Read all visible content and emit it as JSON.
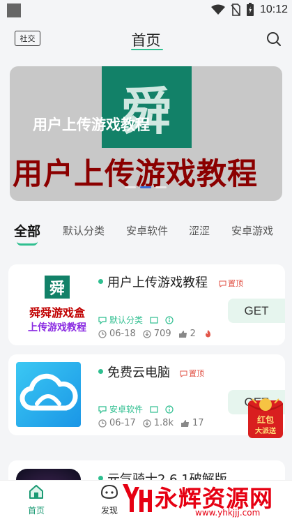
{
  "status_bar": {
    "time": "10:12",
    "icons": [
      "wifi-icon",
      "no-sim-icon",
      "battery-icon"
    ]
  },
  "header": {
    "left_tag": "社交",
    "title": "首页",
    "search_icon": "search-icon"
  },
  "banner": {
    "logo_char": "舜",
    "caption": "用户上传游戏教程",
    "headline": "用户上传游戏教程",
    "slide_count": 3,
    "active_slide": 2
  },
  "tabs": [
    {
      "label": "全部",
      "active": true
    },
    {
      "label": "默认分类",
      "active": false
    },
    {
      "label": "安卓软件",
      "active": false
    },
    {
      "label": "涩涩",
      "active": false
    },
    {
      "label": "安卓游戏",
      "active": false
    }
  ],
  "apps": [
    {
      "name": "用户上传游戏教程",
      "pin": "置顶",
      "category": "默认分类",
      "date": "06-18",
      "downloads": "709",
      "likes": "2",
      "hot": true,
      "action": "GET",
      "icon": {
        "logo_char": "舜",
        "line1": "舜舜游戏盒",
        "line2": "上传游戏教程"
      }
    },
    {
      "name": "免费云电脑",
      "pin": "置顶",
      "category": "安卓软件",
      "date": "06-17",
      "downloads": "1.8k",
      "likes": "17",
      "action": "GET",
      "icon": {
        "name": "cloud-icon"
      }
    },
    {
      "name": "元气骑士2.6.1破解版"
    }
  ],
  "red_packet": {
    "line1": "红包",
    "line2": "大派送"
  },
  "bottom_nav": [
    {
      "label": "首页",
      "icon": "home-icon",
      "active": true
    },
    {
      "label": "发现",
      "icon": "discover-icon",
      "active": false
    }
  ],
  "watermark": {
    "text": "永辉资源网",
    "url": "www.yhkjjj.com"
  },
  "colors": {
    "accent": "#2fbf90",
    "brand_green": "#128168",
    "pin_red": "#e2564a",
    "headline_red": "#8b0000",
    "active_dot": "#3a6ed8"
  }
}
